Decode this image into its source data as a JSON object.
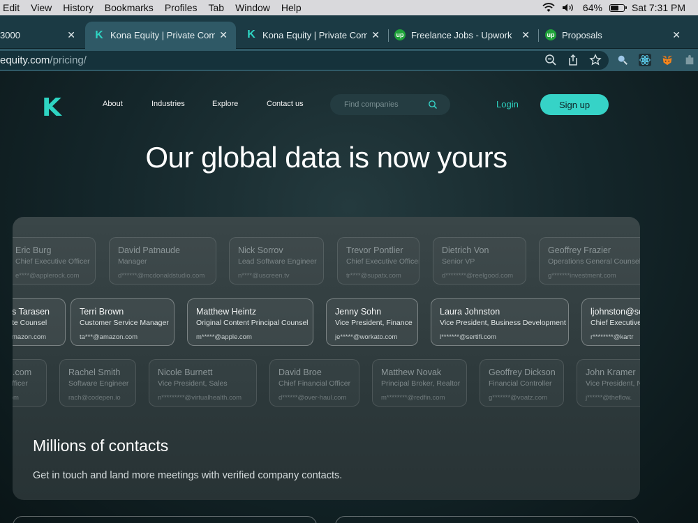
{
  "menubar": {
    "items": [
      "Edit",
      "View",
      "History",
      "Bookmarks",
      "Profiles",
      "Tab",
      "Window",
      "Help"
    ],
    "battery_percent": "64%",
    "battery_level": 0.64,
    "clock": "Sat 7:31 PM"
  },
  "tabs": [
    {
      "title": "3000",
      "favicon": "none",
      "close": "✕"
    },
    {
      "title": "Kona Equity | Private Comp",
      "favicon": "kona-icon",
      "close": "✕",
      "active": true
    },
    {
      "title": "Kona Equity | Private Comp",
      "favicon": "kona-icon",
      "close": "✕"
    },
    {
      "title": "Freelance Jobs - Upwork",
      "favicon": "upwork-icon",
      "close": "✕"
    },
    {
      "title": "Proposals",
      "favicon": "upwork-icon",
      "close": "✕"
    }
  ],
  "address_bar": {
    "host": "equity.com",
    "path": "/pricing/"
  },
  "site": {
    "logo": "K",
    "nav": [
      "About",
      "Industries",
      "Explore",
      "Contact us"
    ],
    "search_placeholder": "Find companies",
    "login": "Login",
    "signup": "Sign up",
    "hero_title": "Our global data is now yours"
  },
  "contacts": {
    "rows": [
      [
        {
          "name": "Eric Burg",
          "title": "Chief Executive Officer",
          "email": "e****@applerock.com"
        },
        {
          "name": "David Patnaude",
          "title": "Manager",
          "email": "d******@mcdonaldstudio.com"
        },
        {
          "name": "Nick Sorrov",
          "title": "Lead Software Engineer",
          "email": "n****@uscreen.tv"
        },
        {
          "name": "Trevor Pontlier",
          "title": "Chief Executive Officer",
          "email": "tr****@supatx.com"
        },
        {
          "name": "Dietrich Von",
          "title": "Senior VP",
          "email": "d********@reelgood.com"
        },
        {
          "name": "Geoffrey Frazier",
          "title": "Operations General Counsel",
          "email": "g*******investment.com"
        }
      ],
      [
        {
          "name": "s Tarasen",
          "title": "te Counsel",
          "email": "mazon.com"
        },
        {
          "name": "Terri Brown",
          "title": "Customer Service Manager",
          "email": "ta***@amazon.com"
        },
        {
          "name": "Matthew Heintz",
          "title": "Original Content Principal Counsel",
          "email": "m*****@apple.com"
        },
        {
          "name": "Jenny Sohn",
          "title": "Vice President, Finance",
          "email": "je*****@workato.com"
        },
        {
          "name": "Laura Johnston",
          "title": "Vice President, Business Development",
          "email": "l*******@sertifi.com"
        },
        {
          "name": "ljohnston@ser",
          "title": "Chief Executive",
          "email": "r********@kartr"
        }
      ],
      [
        {
          "name": "ifi.com",
          "title": "Officer",
          "email": "com"
        },
        {
          "name": "Rachel Smith",
          "title": "Software Engineer",
          "email": "rach@codepen.io"
        },
        {
          "name": "Nicole Burnett",
          "title": "Vice President, Sales",
          "email": "n*********@virtualhealth.com"
        },
        {
          "name": "David Broe",
          "title": "Chief Financial Officer",
          "email": "d******@over-haul.com"
        },
        {
          "name": "Matthew Novak",
          "title": "Principal Broker, Realtor",
          "email": "m********@redfin.com"
        },
        {
          "name": "Geoffrey Dickson",
          "title": "Financial Controller",
          "email": "g*******@voatz.com"
        },
        {
          "name": "John Kramer",
          "title": "Vice President, N",
          "email": "j******@theflow."
        }
      ]
    ]
  },
  "section": {
    "heading": "Millions of contacts",
    "subtext": "Get in touch and land more meetings with verified company contacts."
  }
}
